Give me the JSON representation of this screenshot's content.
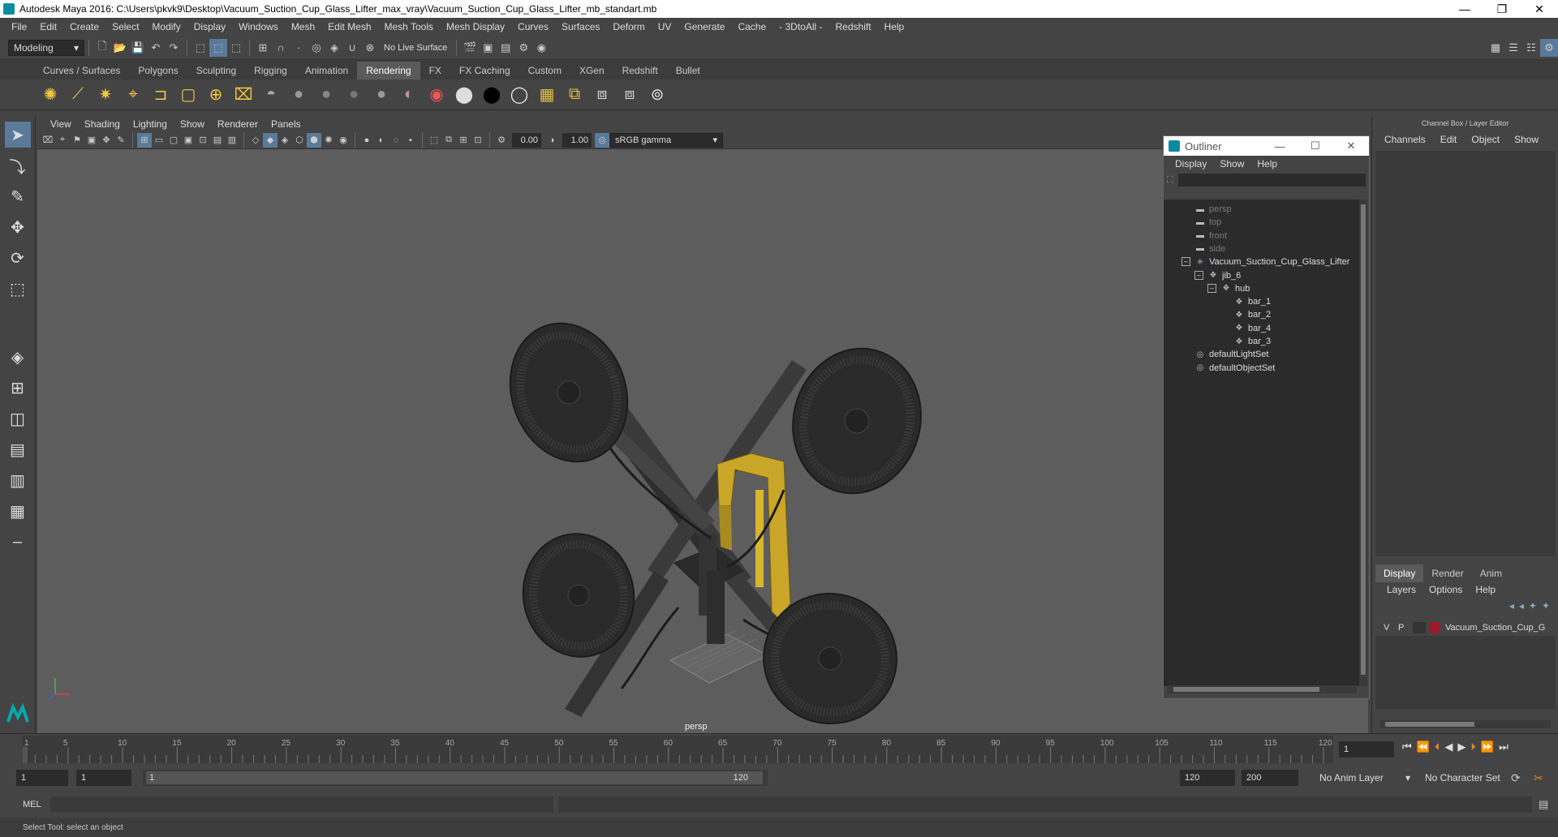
{
  "window": {
    "title": "Autodesk Maya 2016: C:\\Users\\pkvk9\\Desktop\\Vacuum_Suction_Cup_Glass_Lifter_max_vray\\Vacuum_Suction_Cup_Glass_Lifter_mb_standart.mb"
  },
  "menubar": [
    "File",
    "Edit",
    "Create",
    "Select",
    "Modify",
    "Display",
    "Windows",
    "Mesh",
    "Edit Mesh",
    "Mesh Tools",
    "Mesh Display",
    "Curves",
    "Surfaces",
    "Deform",
    "UV",
    "Generate",
    "Cache",
    "- 3DtoAll -",
    "Redshift",
    "Help"
  ],
  "toolbar": {
    "mode": "Modeling",
    "live_surface": "No Live Surface"
  },
  "shelf_tabs": [
    "Curves / Surfaces",
    "Polygons",
    "Sculpting",
    "Rigging",
    "Animation",
    "Rendering",
    "FX",
    "FX Caching",
    "Custom",
    "XGen",
    "Redshift",
    "Bullet"
  ],
  "shelf_active": "Rendering",
  "viewport": {
    "menu": [
      "View",
      "Shading",
      "Lighting",
      "Show",
      "Renderer",
      "Panels"
    ],
    "exposure": "0.00",
    "gamma": "1.00",
    "color_space": "sRGB gamma",
    "camera_label": "persp"
  },
  "outliner": {
    "title": "Outliner",
    "menu": [
      "Display",
      "Show",
      "Help"
    ],
    "items": [
      {
        "label": "persp",
        "icon": "camera-icon",
        "dim": true
      },
      {
        "label": "top",
        "icon": "camera-icon",
        "dim": true
      },
      {
        "label": "front",
        "icon": "camera-icon",
        "dim": true
      },
      {
        "label": "side",
        "icon": "camera-icon",
        "dim": true
      },
      {
        "label": "Vacuum_Suction_Cup_Glass_Lifter",
        "icon": "transform-icon",
        "dim": false
      },
      {
        "label": "jib_6",
        "icon": "mesh-icon",
        "dim": false
      },
      {
        "label": "hub",
        "icon": "mesh-icon",
        "dim": false
      },
      {
        "label": "bar_1",
        "icon": "mesh-icon",
        "dim": false
      },
      {
        "label": "bar_2",
        "icon": "mesh-icon",
        "dim": false
      },
      {
        "label": "bar_4",
        "icon": "mesh-icon",
        "dim": false
      },
      {
        "label": "bar_3",
        "icon": "mesh-icon",
        "dim": false
      },
      {
        "label": "defaultLightSet",
        "icon": "set-icon",
        "dim": false
      },
      {
        "label": "defaultObjectSet",
        "icon": "set-icon",
        "dim": false
      }
    ]
  },
  "channel_box": {
    "title": "Channel Box / Layer Editor",
    "menu": [
      "Channels",
      "Edit",
      "Object",
      "Show"
    ],
    "layer_tabs": [
      "Display",
      "Render",
      "Anim"
    ],
    "layer_active": "Display",
    "layer_menu": [
      "Layers",
      "Options",
      "Help"
    ],
    "layer": {
      "v": "V",
      "p": "P",
      "name": "Vacuum_Suction_Cup_G",
      "color": "#9b1a2a"
    }
  },
  "timeline": {
    "ticks": [
      "1",
      "5",
      "10",
      "15",
      "20",
      "25",
      "30",
      "35",
      "40",
      "45",
      "50",
      "55",
      "60",
      "65",
      "70",
      "75",
      "80",
      "85",
      "90",
      "95",
      "100",
      "105",
      "110",
      "115",
      "120"
    ],
    "current_frame": "1"
  },
  "range": {
    "start": "1",
    "playback_start": "1",
    "slider_start": "1",
    "slider_end": "120",
    "playback_end": "120",
    "end": "200",
    "anim_layer": "No Anim Layer",
    "character_set": "No Character Set"
  },
  "command": {
    "label": "MEL"
  },
  "status": {
    "text": "Select Tool: select an object"
  }
}
